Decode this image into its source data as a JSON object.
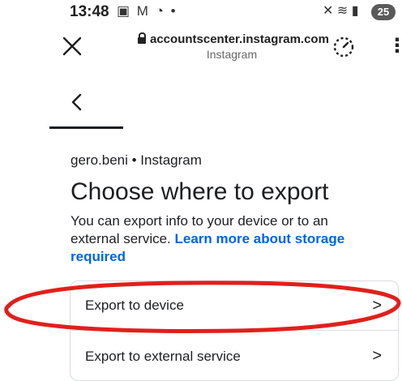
{
  "status_bar": {
    "time": "13:48",
    "left_icons": "▣ M ◔ •",
    "right_icons": "✕ ≋ ▮",
    "battery": "25"
  },
  "browser": {
    "url": "accountscenter.instagram.com",
    "site_name": "Instagram"
  },
  "page": {
    "account_line": "gero.beni • Instagram",
    "title": "Choose where to export",
    "description": "You can export info to your device or to an external service. ",
    "learn_more_link": "Learn more about storage required",
    "options": [
      {
        "label": "Export to device"
      },
      {
        "label": "Export to external service"
      }
    ]
  },
  "annotation": {
    "color": "#e0201b"
  }
}
